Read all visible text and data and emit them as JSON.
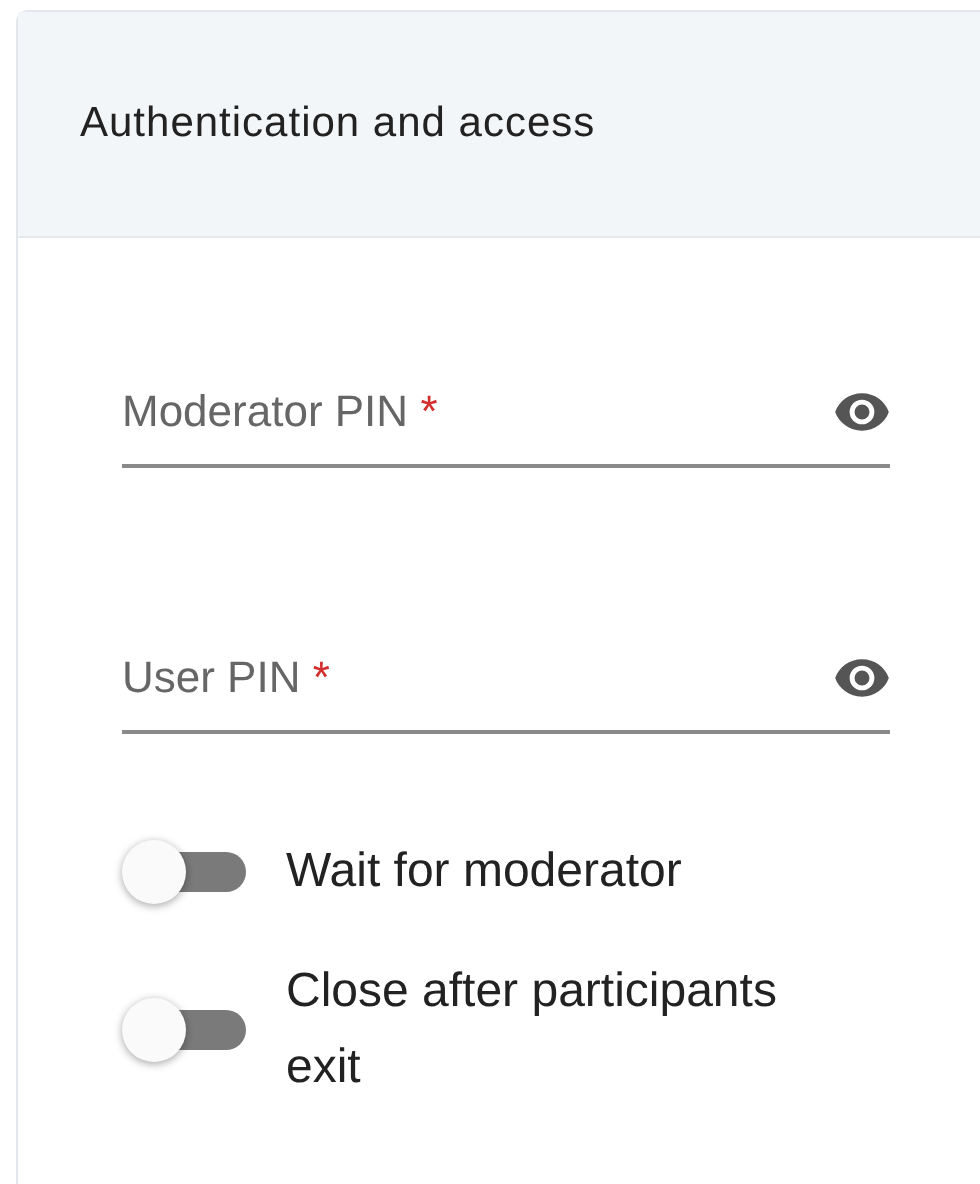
{
  "header": {
    "title": "Authentication and access"
  },
  "fields": [
    {
      "label": "Moderator PIN",
      "required_mark": "*"
    },
    {
      "label": "User PIN",
      "required_mark": "*"
    }
  ],
  "toggles": [
    {
      "label": "Wait for moderator",
      "on": false
    },
    {
      "label": "Close after participants exit",
      "on": false
    }
  ]
}
